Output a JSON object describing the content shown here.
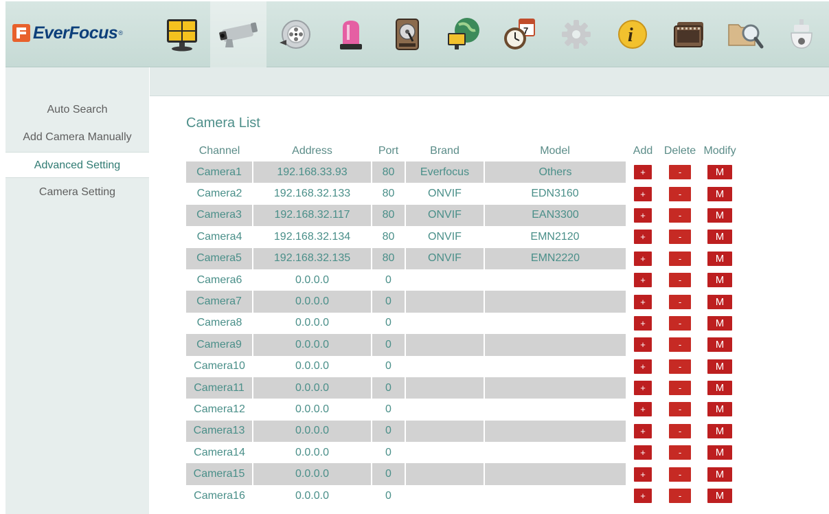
{
  "header": {
    "logo_text": "EverFocus",
    "logo_reg": "®",
    "toolbar": [
      {
        "name": "live-view-icon",
        "active": false
      },
      {
        "name": "camera-icon",
        "active": true
      },
      {
        "name": "playback-reel-icon",
        "active": false
      },
      {
        "name": "alarm-light-icon",
        "active": false
      },
      {
        "name": "hard-disk-icon",
        "active": false
      },
      {
        "name": "network-globe-icon",
        "active": false
      },
      {
        "name": "schedule-clock-calendar-icon",
        "active": false
      },
      {
        "name": "settings-gear-icon",
        "active": false
      },
      {
        "name": "info-icon",
        "active": false
      },
      {
        "name": "film-strip-icon",
        "active": false
      },
      {
        "name": "search-folder-icon",
        "active": false
      },
      {
        "name": "ptz-dome-icon",
        "active": false
      }
    ],
    "colors": {
      "accent": "#4e8f8a",
      "button_red": "#bd1f20",
      "logo_orange": "#e8612c",
      "logo_blue": "#0d3f7a"
    }
  },
  "sidebar": {
    "items": [
      {
        "label": "Auto Search",
        "active": false
      },
      {
        "label": "Add Camera Manually",
        "active": false
      },
      {
        "label": "Advanced Setting",
        "active": true
      },
      {
        "label": "Camera Setting",
        "active": false
      }
    ]
  },
  "main": {
    "title": "Camera List",
    "columns": [
      "Channel",
      "Address",
      "Port",
      "Brand",
      "Model",
      "Add",
      "Delete",
      "Modify"
    ],
    "buttons": {
      "add": "+",
      "delete": "-",
      "modify": "M"
    },
    "rows": [
      {
        "channel": "Camera1",
        "address": "192.168.33.93",
        "port": "80",
        "brand": "Everfocus",
        "model": "Others"
      },
      {
        "channel": "Camera2",
        "address": "192.168.32.133",
        "port": "80",
        "brand": "ONVIF",
        "model": "EDN3160"
      },
      {
        "channel": "Camera3",
        "address": "192.168.32.117",
        "port": "80",
        "brand": "ONVIF",
        "model": "EAN3300"
      },
      {
        "channel": "Camera4",
        "address": "192.168.32.134",
        "port": "80",
        "brand": "ONVIF",
        "model": "EMN2120"
      },
      {
        "channel": "Camera5",
        "address": "192.168.32.135",
        "port": "80",
        "brand": "ONVIF",
        "model": "EMN2220"
      },
      {
        "channel": "Camera6",
        "address": "0.0.0.0",
        "port": "0",
        "brand": "",
        "model": ""
      },
      {
        "channel": "Camera7",
        "address": "0.0.0.0",
        "port": "0",
        "brand": "",
        "model": ""
      },
      {
        "channel": "Camera8",
        "address": "0.0.0.0",
        "port": "0",
        "brand": "",
        "model": ""
      },
      {
        "channel": "Camera9",
        "address": "0.0.0.0",
        "port": "0",
        "brand": "",
        "model": ""
      },
      {
        "channel": "Camera10",
        "address": "0.0.0.0",
        "port": "0",
        "brand": "",
        "model": ""
      },
      {
        "channel": "Camera11",
        "address": "0.0.0.0",
        "port": "0",
        "brand": "",
        "model": ""
      },
      {
        "channel": "Camera12",
        "address": "0.0.0.0",
        "port": "0",
        "brand": "",
        "model": ""
      },
      {
        "channel": "Camera13",
        "address": "0.0.0.0",
        "port": "0",
        "brand": "",
        "model": ""
      },
      {
        "channel": "Camera14",
        "address": "0.0.0.0",
        "port": "0",
        "brand": "",
        "model": ""
      },
      {
        "channel": "Camera15",
        "address": "0.0.0.0",
        "port": "0",
        "brand": "",
        "model": ""
      },
      {
        "channel": "Camera16",
        "address": "0.0.0.0",
        "port": "0",
        "brand": "",
        "model": ""
      }
    ]
  }
}
